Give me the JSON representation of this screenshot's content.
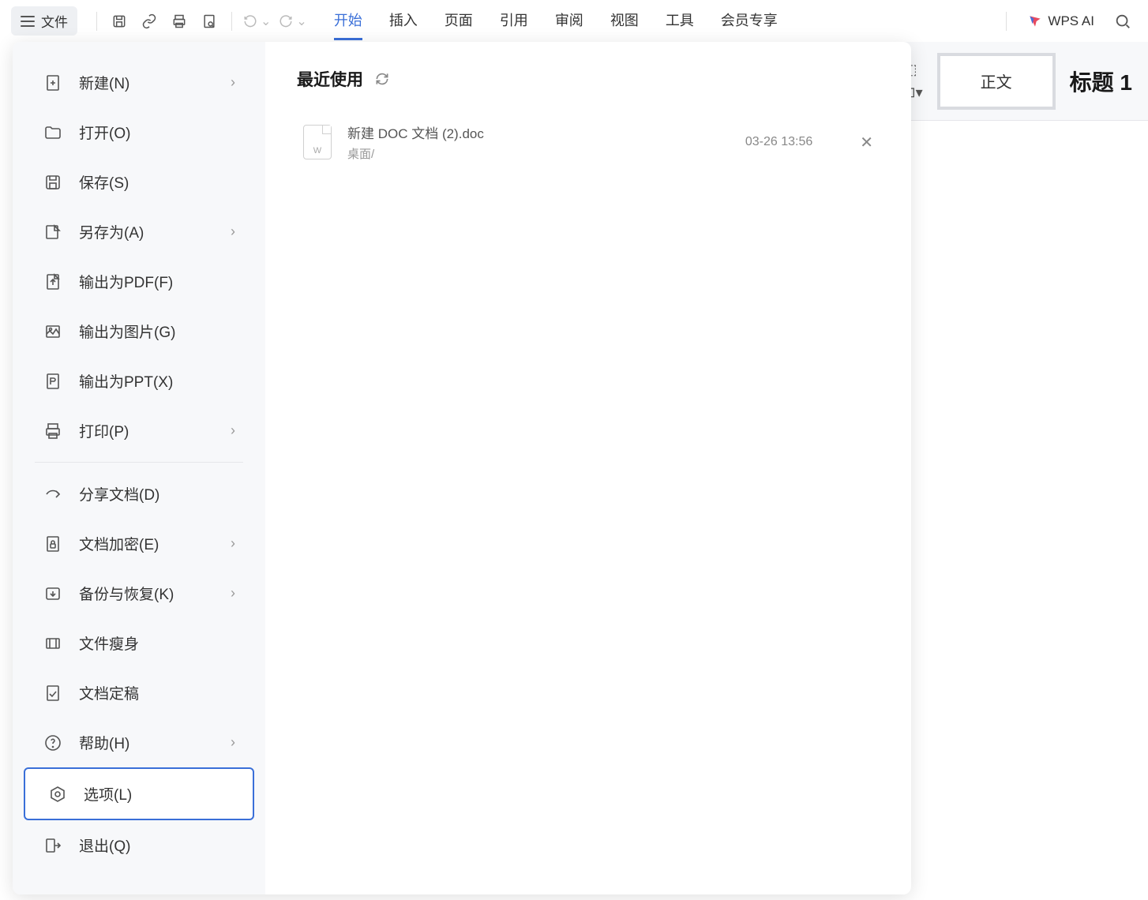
{
  "toolbar": {
    "file_label": "文件"
  },
  "tabs": {
    "start": "开始",
    "insert": "插入",
    "page": "页面",
    "reference": "引用",
    "review": "审阅",
    "view": "视图",
    "tools": "工具",
    "member": "会员专享"
  },
  "wps_ai_label": "WPS AI",
  "styles": {
    "body_text": "正文",
    "heading1": "标题  1"
  },
  "file_menu": {
    "new": "新建(N)",
    "open": "打开(O)",
    "save": "保存(S)",
    "save_as": "另存为(A)",
    "export_pdf": "输出为PDF(F)",
    "export_img": "输出为图片(G)",
    "export_ppt": "输出为PPT(X)",
    "print": "打印(P)",
    "share": "分享文档(D)",
    "encrypt": "文档加密(E)",
    "backup": "备份与恢复(K)",
    "slim": "文件瘦身",
    "finalize": "文档定稿",
    "help": "帮助(H)",
    "options": "选项(L)",
    "exit": "退出(Q)"
  },
  "recent": {
    "header": "最近使用",
    "items": [
      {
        "name": "新建 DOC 文档 (2).doc",
        "path": "桌面/",
        "time": "03-26 13:56"
      }
    ]
  }
}
